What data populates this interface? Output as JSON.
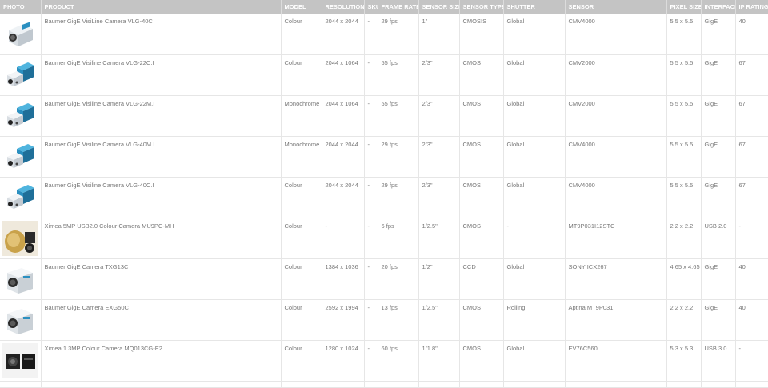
{
  "headers": [
    "PHOTO",
    "PRODUCT",
    "MODEL",
    "RESOLUTION",
    "SKU",
    "FRAME RATE",
    "SENSOR SIZE",
    "SENSOR TYPE",
    "SHUTTER",
    "SENSOR",
    "PIXEL SIZE",
    "INTERFACE",
    "IP RATING"
  ],
  "rows": [
    {
      "photo": "baumer-vlg-white-camera",
      "product": "Baumer GigE VisiLine Camera VLG-40C",
      "model": "Colour",
      "resolution": "2044 x 2044",
      "sku": "-",
      "frame_rate": "29 fps",
      "sensor_size": "1\"",
      "sensor_type": "CMOSIS",
      "shutter": "Global",
      "sensor": "CMV4000",
      "pixel_size": "5.5 x 5.5",
      "interface": "GigE",
      "ip_rating": "40"
    },
    {
      "photo": "baumer-visiline-blue-camera",
      "product": "Baumer GigE Visiline Camera VLG-22C.I",
      "model": "Colour",
      "resolution": "2044 x 1064",
      "sku": "-",
      "frame_rate": "55 fps",
      "sensor_size": "2/3\"",
      "sensor_type": "CMOS",
      "shutter": "Global",
      "sensor": "CMV2000",
      "pixel_size": "5.5 x 5.5",
      "interface": "GigE",
      "ip_rating": "67"
    },
    {
      "photo": "baumer-visiline-blue-camera",
      "product": "Baumer GigE Visiline Camera VLG-22M.I",
      "model": "Monochrome",
      "resolution": "2044 x 1064",
      "sku": "-",
      "frame_rate": "55 fps",
      "sensor_size": "2/3\"",
      "sensor_type": "CMOS",
      "shutter": "Global",
      "sensor": "CMV2000",
      "pixel_size": "5.5 x 5.5",
      "interface": "GigE",
      "ip_rating": "67"
    },
    {
      "photo": "baumer-visiline-blue-camera",
      "product": "Baumer GigE Visiline Camera VLG-40M.I",
      "model": "Monochrome",
      "resolution": "2044 x 2044",
      "sku": "-",
      "frame_rate": "29 fps",
      "sensor_size": "2/3\"",
      "sensor_type": "CMOS",
      "shutter": "Global",
      "sensor": "CMV4000",
      "pixel_size": "5.5 x 5.5",
      "interface": "GigE",
      "ip_rating": "67"
    },
    {
      "photo": "baumer-visiline-blue-camera",
      "product": "Baumer GigE Visiline Camera VLG-40C.I",
      "model": "Colour",
      "resolution": "2044 x 2044",
      "sku": "-",
      "frame_rate": "29 fps",
      "sensor_size": "2/3\"",
      "sensor_type": "CMOS",
      "shutter": "Global",
      "sensor": "CMV4000",
      "pixel_size": "5.5 x 5.5",
      "interface": "GigE",
      "ip_rating": "67"
    },
    {
      "photo": "ximea-gold-usb-camera",
      "product": "Ximea 5MP USB2.0 Colour Camera MU9PC-MH",
      "model": "Colour",
      "resolution": "-",
      "sku": "-",
      "frame_rate": "6 fps",
      "sensor_size": "1/2.5\"",
      "sensor_type": "CMOS",
      "shutter": "-",
      "sensor": "MT9P031I12STC",
      "pixel_size": "2.2 x 2.2",
      "interface": "USB 2.0",
      "ip_rating": "-"
    },
    {
      "photo": "baumer-white-box-camera",
      "product": "Baumer GigE Camera TXG13C",
      "model": "Colour",
      "resolution": "1384 x 1036",
      "sku": "-",
      "frame_rate": "20 fps",
      "sensor_size": "1/2\"",
      "sensor_type": "CCD",
      "shutter": "Global",
      "sensor": "SONY ICX267",
      "pixel_size": "4.65 x 4.65",
      "interface": "GigE",
      "ip_rating": "40"
    },
    {
      "photo": "baumer-white-box-camera",
      "product": "Baumer GigE Camera EXG50C",
      "model": "Colour",
      "resolution": "2592 x 1994",
      "sku": "-",
      "frame_rate": "13 fps",
      "sensor_size": "1/2.5\"",
      "sensor_type": "CMOS",
      "shutter": "Rolling",
      "sensor": "Aptina MT9P031",
      "pixel_size": "2.2 x 2.2",
      "interface": "GigE",
      "ip_rating": "40"
    },
    {
      "photo": "ximea-black-camera-pair",
      "product": "Ximea 1.3MP Colour Camera MQ013CG-E2",
      "model": "Colour",
      "resolution": "1280 x 1024",
      "sku": "-",
      "frame_rate": "60 fps",
      "sensor_size": "1/1.8\"",
      "sensor_type": "CMOS",
      "shutter": "Global",
      "sensor": "EV76C560",
      "pixel_size": "5.3 x 5.3",
      "interface": "USB 3.0",
      "ip_rating": "-"
    }
  ],
  "colors": {
    "header_bg": "#c4c4c4",
    "header_text": "#ffffff",
    "cell_text": "#777777",
    "accent_blue": "#2a8fc0"
  }
}
